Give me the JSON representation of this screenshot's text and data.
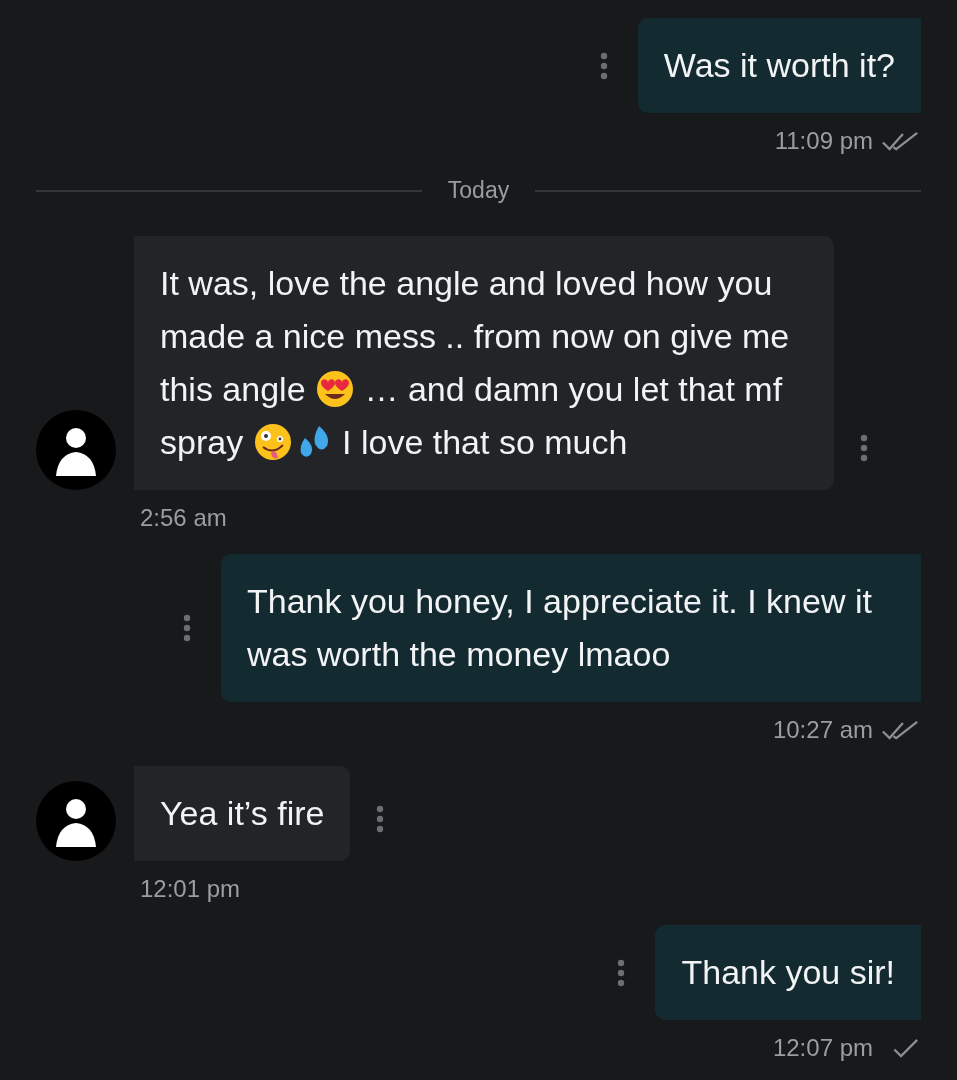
{
  "messages": [
    {
      "kind": "outgoing",
      "parts": [
        {
          "kind": "text",
          "text": "Was it worth it?"
        }
      ],
      "time": "11:09 pm",
      "read": true
    },
    {
      "kind": "date_divider",
      "label": "Today"
    },
    {
      "kind": "incoming",
      "parts": [
        {
          "kind": "text",
          "text": "It was, love the angle and loved how you made a nice mess .. from now on give me this angle "
        },
        {
          "kind": "emoji_heart_eyes"
        },
        {
          "kind": "text",
          "text": " … and damn you let that mf spray "
        },
        {
          "kind": "emoji_zany"
        },
        {
          "kind": "emoji_droplets"
        },
        {
          "kind": "text",
          "text": " I love that so much"
        }
      ],
      "time": "2:56 am"
    },
    {
      "kind": "outgoing",
      "parts": [
        {
          "kind": "text",
          "text": "Thank you honey, I appreciate it. I knew it was worth the money lmaoo"
        }
      ],
      "time": "10:27 am",
      "read": true
    },
    {
      "kind": "incoming",
      "parts": [
        {
          "kind": "text",
          "text": "Yea it’s fire"
        }
      ],
      "time": "12:01 pm"
    },
    {
      "kind": "outgoing",
      "parts": [
        {
          "kind": "text",
          "text": "Thank you sir!"
        }
      ],
      "time": "12:07 pm",
      "read": false
    }
  ]
}
